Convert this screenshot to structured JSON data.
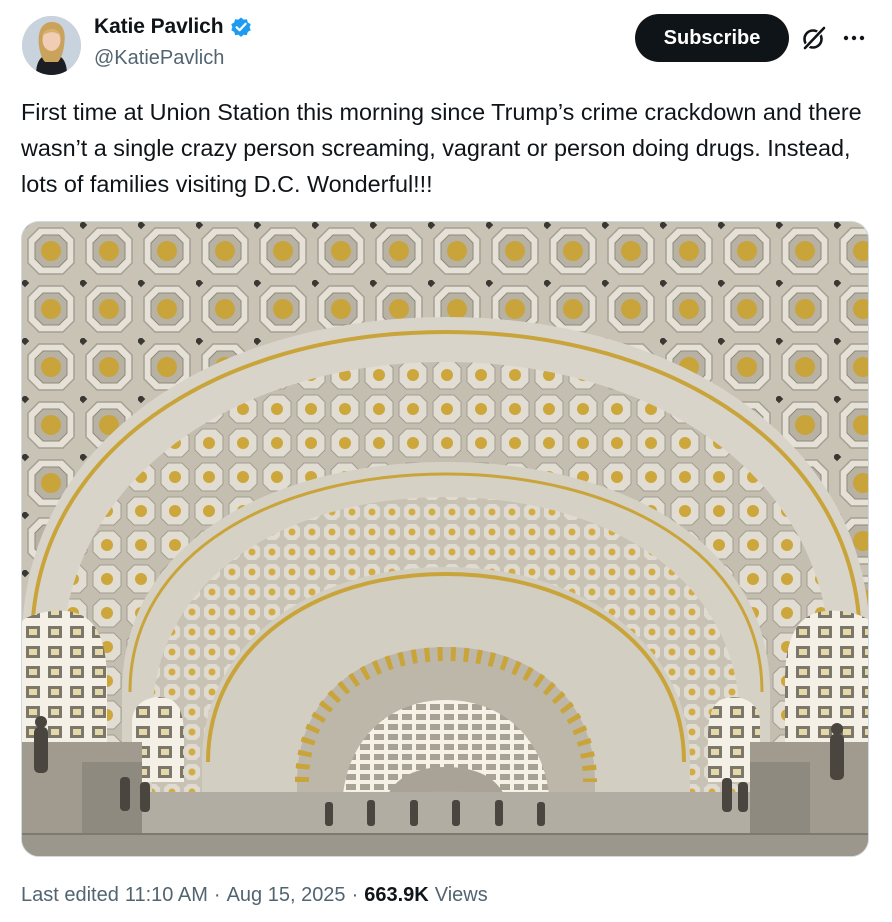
{
  "author": {
    "display_name": "Katie Pavlich",
    "handle": "@KatiePavlich",
    "verified": true,
    "avatar_icon": "profile-photo"
  },
  "actions": {
    "subscribe_label": "Subscribe",
    "grok_icon": "grok-icon",
    "more_icon": "more-options-icon"
  },
  "tweet": {
    "text": "First time at Union Station this morning since Trump’s crime crackdown and there wasn’t a single crazy person screaming, vagrant or person doing drugs. Instead, lots of families visiting D.C. Wonderful!!!"
  },
  "media": {
    "description_icon": "photo-union-station-vaulted-ceiling"
  },
  "footer": {
    "edited_label": "Last edited",
    "time": "11:10 AM",
    "date": "Aug 15, 2025",
    "views_count": "663.9K",
    "views_label": "Views",
    "separator": "·"
  },
  "colors": {
    "text_primary": "#0f1419",
    "text_secondary": "#536471",
    "verified_blue": "#1d9bf0",
    "button_dark": "#0f1419"
  }
}
